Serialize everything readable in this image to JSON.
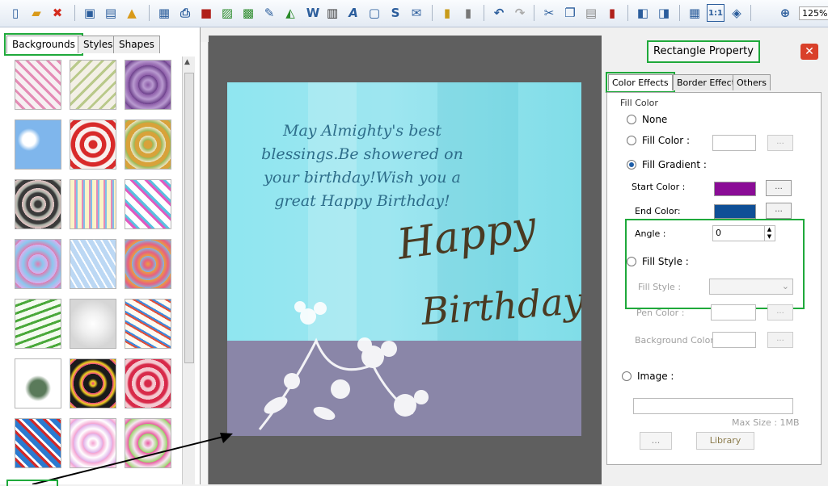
{
  "zoom": "125%",
  "left_tabs": [
    "Backgrounds",
    "Styles",
    "Shapes"
  ],
  "card": {
    "message": "May Almighty's best blessings.Be showered on your birthday!Wish you a great Happy Birthday!",
    "happy": "Happy",
    "birthday": "Birthday"
  },
  "panel": {
    "title": "Rectangle Property",
    "tabs": [
      "Color Effects",
      "Border Effect",
      "Others"
    ],
    "fill_color_group": "Fill Color",
    "none": "None",
    "fill_color": "Fill Color :",
    "fill_gradient": "Fill Gradient :",
    "start_color_label": "Start Color :",
    "end_color_label": "End Color:",
    "angle_label": "Angle :",
    "angle_value": "0",
    "fill_style": "Fill Style :",
    "fill_style_label": "Fill Style :",
    "pen_color_label": "Pen Color :",
    "background_color_label": "Background Color :",
    "image": "Image :",
    "max_size": "Max Size : 1MB",
    "dots": "...",
    "library": "Library",
    "colors": {
      "start": "#8a0c96",
      "end": "#0f4f96"
    }
  }
}
